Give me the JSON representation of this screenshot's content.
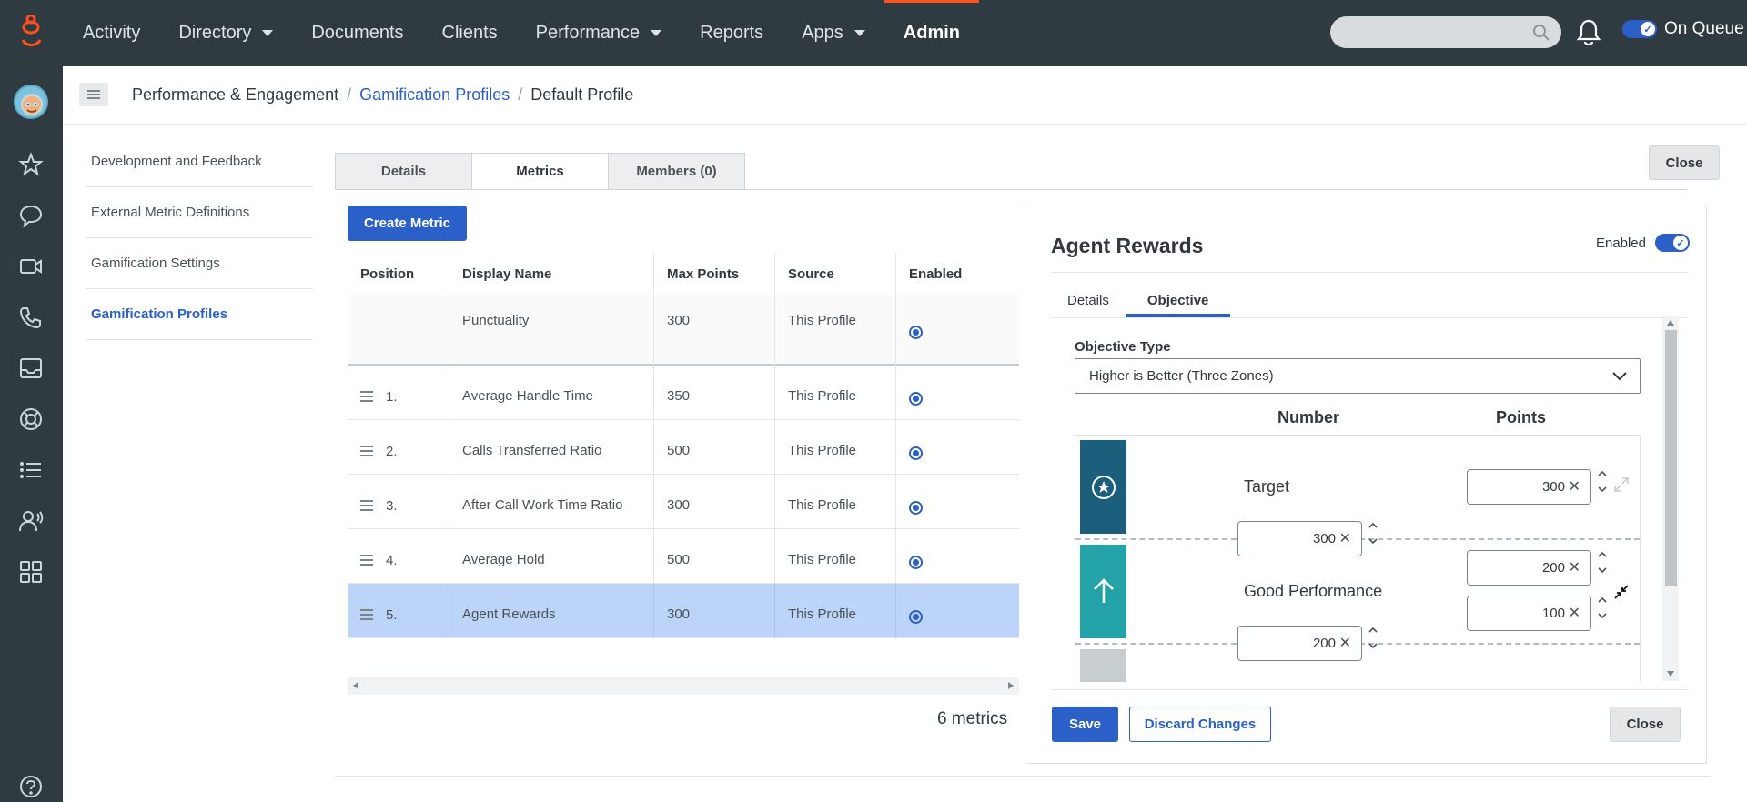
{
  "topnav": {
    "items": [
      {
        "label": "Activity",
        "dropdown": false
      },
      {
        "label": "Directory",
        "dropdown": true
      },
      {
        "label": "Documents",
        "dropdown": false
      },
      {
        "label": "Clients",
        "dropdown": false
      },
      {
        "label": "Performance",
        "dropdown": true
      },
      {
        "label": "Reports",
        "dropdown": false
      },
      {
        "label": "Apps",
        "dropdown": true
      },
      {
        "label": "Admin",
        "dropdown": false,
        "active": true
      }
    ],
    "queue_label": "On Queue",
    "accent": "#ff4f1f"
  },
  "rail_icons": [
    "star-icon",
    "chat-icon",
    "video-icon",
    "phone-icon",
    "inbox-icon",
    "lifebuoy-icon",
    "list-icon",
    "agent-icon",
    "apps-grid-icon",
    "help-icon"
  ],
  "breadcrumb": {
    "root": "Performance & Engagement",
    "parent": "Gamification Profiles",
    "current": "Default Profile",
    "sep": "/"
  },
  "sidebar": {
    "items": [
      {
        "label": "Development and Feedback"
      },
      {
        "label": "External Metric Definitions"
      },
      {
        "label": "Gamification Settings"
      },
      {
        "label": "Gamification Profiles",
        "active": true
      }
    ]
  },
  "tabs": [
    "Details",
    "Metrics",
    "Members (0)"
  ],
  "close_label": "Close",
  "create_metric_label": "Create Metric",
  "table": {
    "headers": [
      "Position",
      "Display Name",
      "Max Points",
      "Source",
      "Enabled"
    ],
    "pinned": {
      "name": "Punctuality",
      "points": "300",
      "source": "This Profile"
    },
    "rows": [
      {
        "pos": "1.",
        "name": "Average Handle Time",
        "points": "350",
        "source": "This Profile"
      },
      {
        "pos": "2.",
        "name": "Calls Transferred Ratio",
        "points": "500",
        "source": "This Profile"
      },
      {
        "pos": "3.",
        "name": "After Call Work Time Ratio",
        "points": "300",
        "source": "This Profile"
      },
      {
        "pos": "4.",
        "name": "Average Hold",
        "points": "500",
        "source": "This Profile"
      },
      {
        "pos": "5.",
        "name": "Agent Rewards",
        "points": "300",
        "source": "This Profile",
        "selected": true
      }
    ],
    "count": "6 metrics"
  },
  "panel": {
    "title": "Agent Rewards",
    "enabled_label": "Enabled",
    "tabs": [
      "Details",
      "Objective"
    ],
    "objective_type_label": "Objective Type",
    "objective_type_value": "Higher is Better (Three Zones)",
    "col_number": "Number",
    "col_points": "Points",
    "zones": [
      {
        "label": "Target",
        "color": "#1b5f7c",
        "points": "300"
      },
      {
        "label": "Good Performance",
        "color": "#23a3a8",
        "points_high": "200",
        "points_low": "100"
      }
    ],
    "thresholds": [
      "300",
      "200"
    ],
    "save_label": "Save",
    "discard_label": "Discard Changes",
    "close_label": "Close"
  }
}
